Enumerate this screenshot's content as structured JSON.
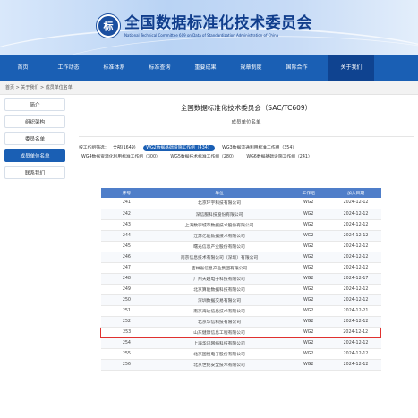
{
  "header": {
    "logo_text": "标",
    "title": "全国数据标准化技术委员会",
    "subtitle": "National Technical Committee 609 on Data of Standardization Administration of China"
  },
  "nav": {
    "items": [
      "首页",
      "工作动态",
      "标准体系",
      "标准查询",
      "重要成果",
      "规章制度",
      "国际合作",
      "关于我们"
    ],
    "active_index": 7
  },
  "breadcrumb": "首页 > 关于我们 > 成员单位名单",
  "sidebar": {
    "items": [
      "简介",
      "组织架构",
      "委员名单",
      "成员单位名单",
      "联系我们"
    ],
    "active_index": 3
  },
  "main": {
    "title": "全国数据标准化技术委员会（SAC/TC609）",
    "subtitle": "成员单位名单",
    "filter_label": "按工作组筛选：",
    "filters_row1": [
      "全部(1649)",
      "WG2数据基础设施工作组（434）",
      "WG3数据流通利用标准工作组（354）"
    ],
    "filters_row2": [
      "WG4数据资源化利用标准工作组（300）",
      "WG5数据技术标准工作组（280）",
      "WG6数据基础设施工作组（241）"
    ],
    "active_filter": "WG2数据基础设施工作组（434）"
  },
  "table": {
    "columns": [
      "序号",
      "单位",
      "工作组",
      "加入日期"
    ],
    "rows": [
      [
        "241",
        "北京环宇科技有限公司",
        "WG2",
        "2024-12-12"
      ],
      [
        "242",
        "深信服科技股份有限公司",
        "WG2",
        "2024-12-12"
      ],
      [
        "243",
        "上海数字城市数据技术股份有限公司",
        "WG2",
        "2024-12-12"
      ],
      [
        "244",
        "江苏亿能数据技术有限公司",
        "WG2",
        "2024-12-12"
      ],
      [
        "245",
        "曙光信息产业股份有限公司",
        "WG2",
        "2024-12-12"
      ],
      [
        "246",
        "南京信息技术有限公司（深圳）有限公司",
        "WG2",
        "2024-12-12"
      ],
      [
        "247",
        "吉林省信息产业集团有限公司",
        "WG2",
        "2024-12-12"
      ],
      [
        "248",
        "广州天越电子科技有限公司",
        "WG2",
        "2024-12-17"
      ],
      [
        "249",
        "北京算能数据科技有限公司",
        "WG2",
        "2024-12-12"
      ],
      [
        "250",
        "深圳数据交易有限公司",
        "WG2",
        "2024-12-12"
      ],
      [
        "251",
        "南京海达信息技术有限公司",
        "WG2",
        "2024-12-21"
      ],
      [
        "252",
        "北京华信科技有限公司",
        "WG2",
        "2024-12-12"
      ],
      [
        "253",
        "山东健康信息工程有限公司",
        "WG2",
        "2024-12-12"
      ],
      [
        "254",
        "上海华讯网络科技有限公司",
        "WG2",
        "2024-12-12"
      ],
      [
        "255",
        "北京国恒电子股份有限公司",
        "WG2",
        "2024-12-12"
      ],
      [
        "256",
        "北京世纪安全技术有限公司",
        "WG2",
        "2024-12-12"
      ]
    ],
    "highlighted_index": 12
  },
  "colors": {
    "nav": "#1a5fb4",
    "nav_active": "#0f4390",
    "table_header": "#4f7ec9",
    "highlight_border": "#e0312f"
  }
}
